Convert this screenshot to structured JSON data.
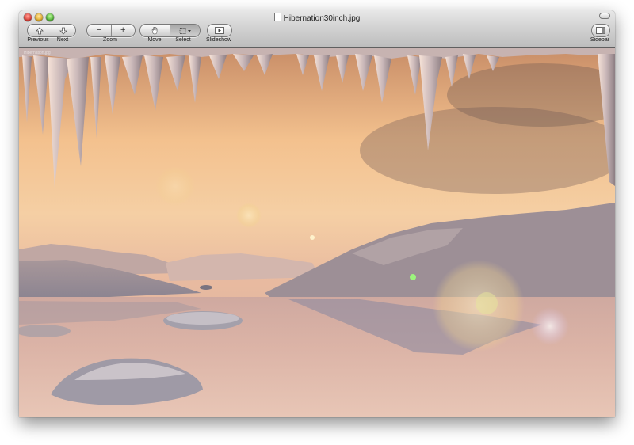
{
  "window": {
    "title": "Hibernation30inch.jpg"
  },
  "toolbar": {
    "previous_label": "Previous",
    "next_label": "Next",
    "zoom_label": "Zoom",
    "zoom_out_glyph": "−",
    "zoom_in_glyph": "+",
    "move_label": "Move",
    "select_label": "Select",
    "slideshow_label": "Slideshow",
    "sidebar_label": "Sidebar"
  },
  "icons": {
    "previous": "up-arrow-icon",
    "next": "down-arrow-icon",
    "move": "hand-icon",
    "select": "marquee-select-icon",
    "slideshow": "play-screen-icon",
    "sidebar": "sidebar-icon"
  },
  "image": {
    "watermark": "Hibernation.jpg",
    "description_colors": {
      "sky_top": "#d9a37a",
      "sky_mid": "#f4c895",
      "water": "#c9a79b"
    }
  }
}
